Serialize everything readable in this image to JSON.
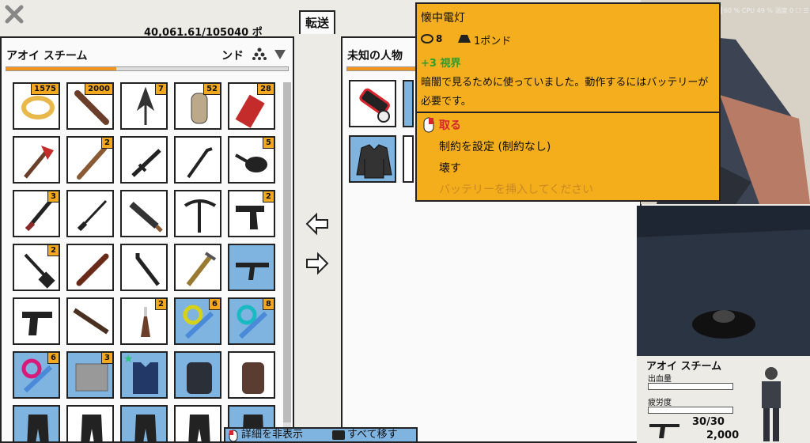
{
  "colors": {
    "accent": "#f4a81f",
    "panel": "#fafafa",
    "blue_slot": "#7fb3e0",
    "green_stat": "#2e9e2e",
    "red_action": "#d7262e"
  },
  "header": {
    "close_icon": "close-icon",
    "weight": "40,061.61/105040 ポ",
    "transfer_tab": "転送"
  },
  "left_panel": {
    "title": "アオイ スチーム",
    "sort_label": "ンド",
    "sort_icon": "sort-icon",
    "dropdown_icon": "chevron-down-icon",
    "capacity_fraction": 0.39,
    "items": [
      {
        "icon": "ring-icon",
        "count": "1575"
      },
      {
        "icon": "plank-icon",
        "count": "2000"
      },
      {
        "icon": "spearhead-icon",
        "count": "7"
      },
      {
        "icon": "cylinder-icon",
        "count": "52"
      },
      {
        "icon": "shotgun-shell-icon",
        "count": "28"
      },
      {
        "icon": "fire-axe-icon",
        "count": ""
      },
      {
        "icon": "baseball-bat-icon",
        "count": "2"
      },
      {
        "icon": "baton-icon",
        "count": ""
      },
      {
        "icon": "crowbar-icon",
        "count": ""
      },
      {
        "icon": "frying-pan-icon",
        "count": "5"
      },
      {
        "icon": "combat-knife-icon",
        "count": "3"
      },
      {
        "icon": "katana-icon",
        "count": ""
      },
      {
        "icon": "machete-icon",
        "count": ""
      },
      {
        "icon": "pickaxe-icon",
        "count": ""
      },
      {
        "icon": "revolver-icon",
        "count": "2"
      },
      {
        "icon": "shovel-icon",
        "count": "2"
      },
      {
        "icon": "nightstick-icon",
        "count": ""
      },
      {
        "icon": "tire-iron-icon",
        "count": ""
      },
      {
        "icon": "pipe-wrench-icon",
        "count": ""
      },
      {
        "icon": "assault-rifle-icon",
        "count": ""
      },
      {
        "icon": "pistol-icon",
        "count": ""
      },
      {
        "icon": "shotgun-icon",
        "count": ""
      },
      {
        "icon": "molotov-icon",
        "count": "2"
      },
      {
        "icon": "syringe-yellow-icon",
        "count": "6"
      },
      {
        "icon": "syringe-cyan-icon",
        "count": "8"
      },
      {
        "icon": "syringe-pink-icon",
        "count": "6"
      },
      {
        "icon": "bandage-icon",
        "count": "3"
      },
      {
        "icon": "body-armor-icon",
        "count": ""
      },
      {
        "icon": "backpack-black-icon",
        "count": ""
      },
      {
        "icon": "backpack-brown-icon",
        "count": ""
      },
      {
        "icon": "pants-icon",
        "count": ""
      },
      {
        "icon": "pants-icon",
        "count": ""
      },
      {
        "icon": "pants-icon",
        "count": ""
      },
      {
        "icon": "pants-icon",
        "count": ""
      },
      {
        "icon": "pants-icon",
        "count": ""
      }
    ]
  },
  "right_panel": {
    "title": "未知の人物",
    "items": [
      {
        "icon": "flashlight-icon"
      },
      {
        "icon": "jacket-icon"
      }
    ]
  },
  "transfer_left_icon": "arrow-left-icon",
  "transfer_right_icon": "arrow-right-icon",
  "tooltip": {
    "title": "懐中電灯",
    "value": "8",
    "weight": "1ポンド",
    "stat": "+3 視界",
    "description": "暗闇で見るために使っていました。動作するにはバッテリーが必要です。",
    "actions": [
      {
        "label": "取る",
        "state": "primary"
      },
      {
        "label": "制約を設定 (制約なし)",
        "state": "normal"
      },
      {
        "label": "壊す",
        "state": "normal"
      },
      {
        "label": "バッテリーを挿入してください",
        "state": "disabled"
      }
    ]
  },
  "status_bar": {
    "text": "FPS 59 ████ 60 % CPU 49 % 温度 0 ☐ ☰"
  },
  "character": {
    "name": "アオイ スチーム",
    "bleed_label": "出血量",
    "fatigue_label": "疲労度",
    "ammo": "30/30",
    "reserve": "2,000"
  },
  "bottom_bar": {
    "hide_details": "詳細を非表示",
    "move_all": "すべて移す"
  }
}
